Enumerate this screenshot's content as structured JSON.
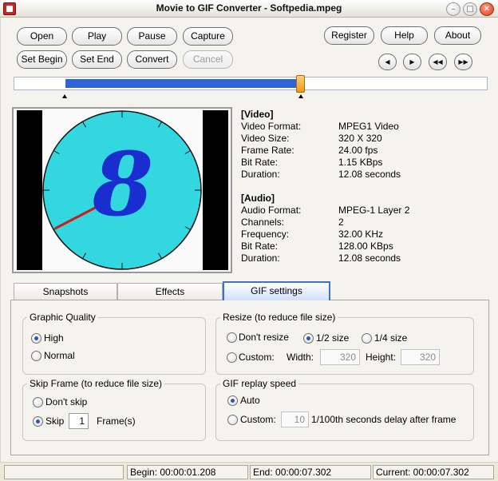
{
  "window": {
    "title": "Movie to GIF Converter - Softpedia.mpeg",
    "controls": {
      "minimize": "–",
      "maximize": "□",
      "close": "✕"
    }
  },
  "toolbar": {
    "open": "Open",
    "play": "Play",
    "pause": "Pause",
    "capture": "Capture",
    "set_begin": "Set Begin",
    "set_end": "Set End",
    "convert": "Convert",
    "cancel": "Cancel",
    "register": "Register",
    "help": "Help",
    "about": "About",
    "nav_icons": [
      "prev-icon",
      "next-icon",
      "rewind-icon",
      "fast-forward-icon"
    ]
  },
  "timeline": {
    "selection_start": 0.108,
    "selection_end": 0.606,
    "colors": {
      "fill": "#2f63d8",
      "thumb": "#f0a020"
    }
  },
  "preview": {
    "clock_digit": "8",
    "colors": {
      "face": "#33d7e0",
      "digit": "#1a2ed0",
      "hand": "#d11a1a",
      "bars": "#000000"
    }
  },
  "info": {
    "video": {
      "heading": "[Video]",
      "rows": [
        {
          "label": "Video Format:",
          "value": "MPEG1 Video"
        },
        {
          "label": "Video Size:",
          "value": "320 X 320"
        },
        {
          "label": "Frame Rate:",
          "value": "24.00 fps"
        },
        {
          "label": "Bit Rate:",
          "value": "1.15 KBps"
        },
        {
          "label": "Duration:",
          "value": "12.08 seconds"
        }
      ]
    },
    "audio": {
      "heading": "[Audio]",
      "rows": [
        {
          "label": "Audio Format:",
          "value": "MPEG-1 Layer 2"
        },
        {
          "label": "Channels:",
          "value": "2"
        },
        {
          "label": "Frequency:",
          "value": "32.00 KHz"
        },
        {
          "label": "Bit Rate:",
          "value": "128.00 KBps"
        },
        {
          "label": "Duration:",
          "value": "12.08 seconds"
        }
      ]
    }
  },
  "tabs": [
    "Snapshots",
    "Effects",
    "GIF settings"
  ],
  "gif_settings": {
    "quality": {
      "title": "Graphic Quality",
      "options": [
        "High",
        "Normal"
      ],
      "selected": "High"
    },
    "resize": {
      "title": "Resize (to reduce file size)",
      "options": [
        "Don't resize",
        "1/2 size",
        "1/4 size"
      ],
      "selected": "1/2 size",
      "custom_label": "Custom:",
      "width_label": "Width:",
      "width_value": "320",
      "height_label": "Height:",
      "height_value": "320"
    },
    "skip": {
      "title": "Skip Frame (to reduce file size)",
      "dont_skip": "Don't skip",
      "skip_label": "Skip",
      "skip_value": "1",
      "frames_label": "Frame(s)",
      "selected": "Skip"
    },
    "replay": {
      "title": "GIF replay speed",
      "auto": "Auto",
      "custom": "Custom:",
      "custom_value": "10",
      "suffix": "1/100th seconds delay after frame",
      "selected": "Auto"
    }
  },
  "status": {
    "begin": "Begin: 00:00:01.208",
    "end": "End: 00:00:07.302",
    "current": "Current: 00:00:07.302"
  }
}
